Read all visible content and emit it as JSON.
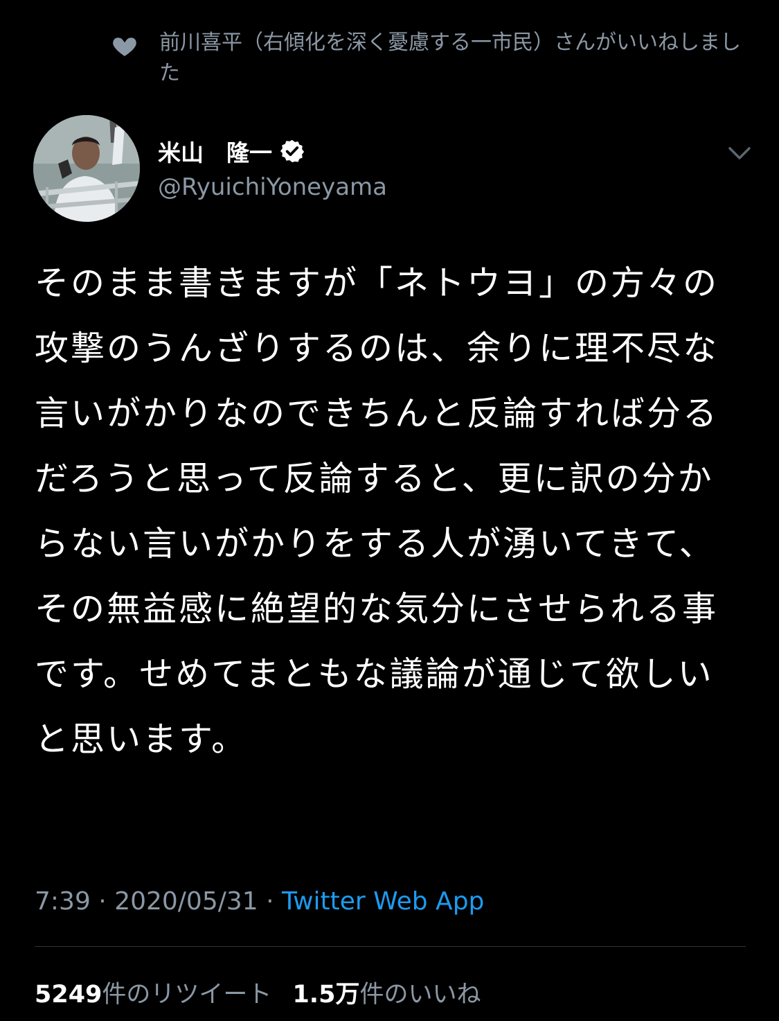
{
  "social_context": {
    "icon": "heart-icon",
    "text": "前川喜平（右傾化を深く憂慮する一市民）さんがいいねしました"
  },
  "author": {
    "avatar": "avatar-photo",
    "display_name": "米山　隆一",
    "verified_icon": "verified-badge-icon",
    "handle": "@RyuichiYoneyama",
    "menu_icon": "chevron-down-icon"
  },
  "tweet": {
    "text": "そのまま書きますが「ネトウヨ」の方々の攻撃のうんざりするのは、余りに理不尽な言いがかりなのできちんと反論すれば分るだろうと思って反論すると、更に訳の分からない言いがかりをする人が湧いてきて、その無益感に絶望的な気分にさせられる事です。せめてまともな議論が通じて欲しいと思います。",
    "time": "7:39",
    "sep1": " · ",
    "date": "2020/05/31",
    "sep2": " · ",
    "source": "Twitter Web App"
  },
  "stats": {
    "retweets_count": "5249",
    "retweets_label": "件のリツイート",
    "likes_count": "1.5万",
    "likes_label": "件のいいね"
  },
  "colors": {
    "background": "#000000",
    "text": "#ffffff",
    "secondary": "#8b98a5",
    "link": "#1d9bf0"
  }
}
